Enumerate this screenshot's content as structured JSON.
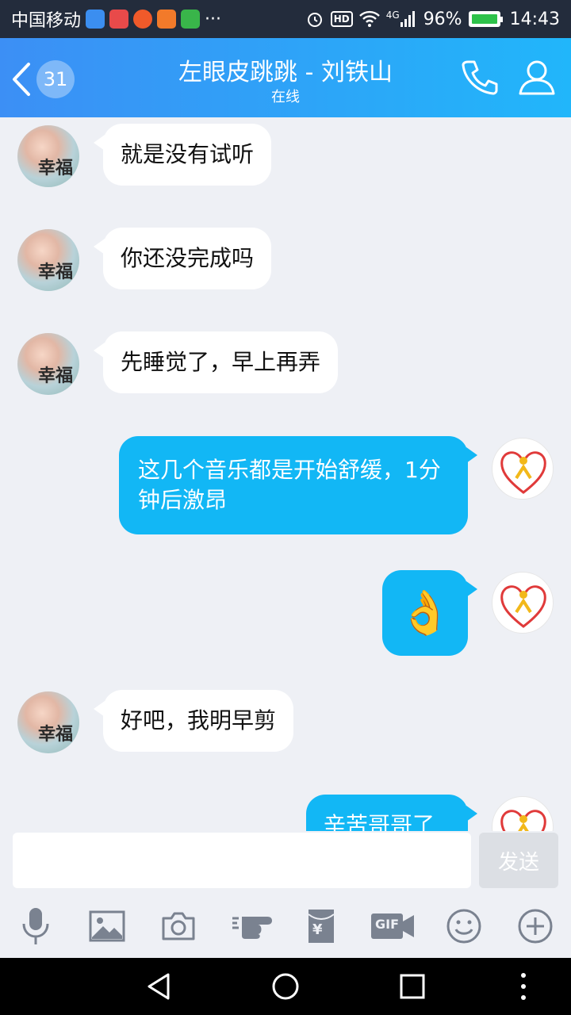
{
  "status_bar": {
    "carrier": "中国移动",
    "overflow": "···",
    "hd": "HD",
    "network": "4G",
    "battery": "96%",
    "time": "14:43"
  },
  "header": {
    "unread_count": "31",
    "title": "左眼皮跳跳 - 刘铁山",
    "status": "在线"
  },
  "messages": [
    {
      "side": "in",
      "text": "就是没有试听"
    },
    {
      "side": "in",
      "text": "你还没完成吗"
    },
    {
      "side": "in",
      "text": "先睡觉了，早上再弄"
    },
    {
      "side": "out",
      "text": "这几个音乐都是开始舒缓，1分钟后激昂"
    },
    {
      "side": "out",
      "emoji": "👌"
    },
    {
      "side": "in",
      "text": "好吧，我明早剪"
    },
    {
      "side": "out",
      "text": "辛苦哥哥了"
    }
  ],
  "avatar_caption": "幸福",
  "input": {
    "value": "",
    "placeholder": ""
  },
  "send_label": "发送",
  "toolbar": {
    "gif_label": "GIF",
    "yen": "¥"
  },
  "colors": {
    "accent": "#12b7f5",
    "header_start": "#3c8ff5",
    "header_end": "#21b6fa"
  }
}
